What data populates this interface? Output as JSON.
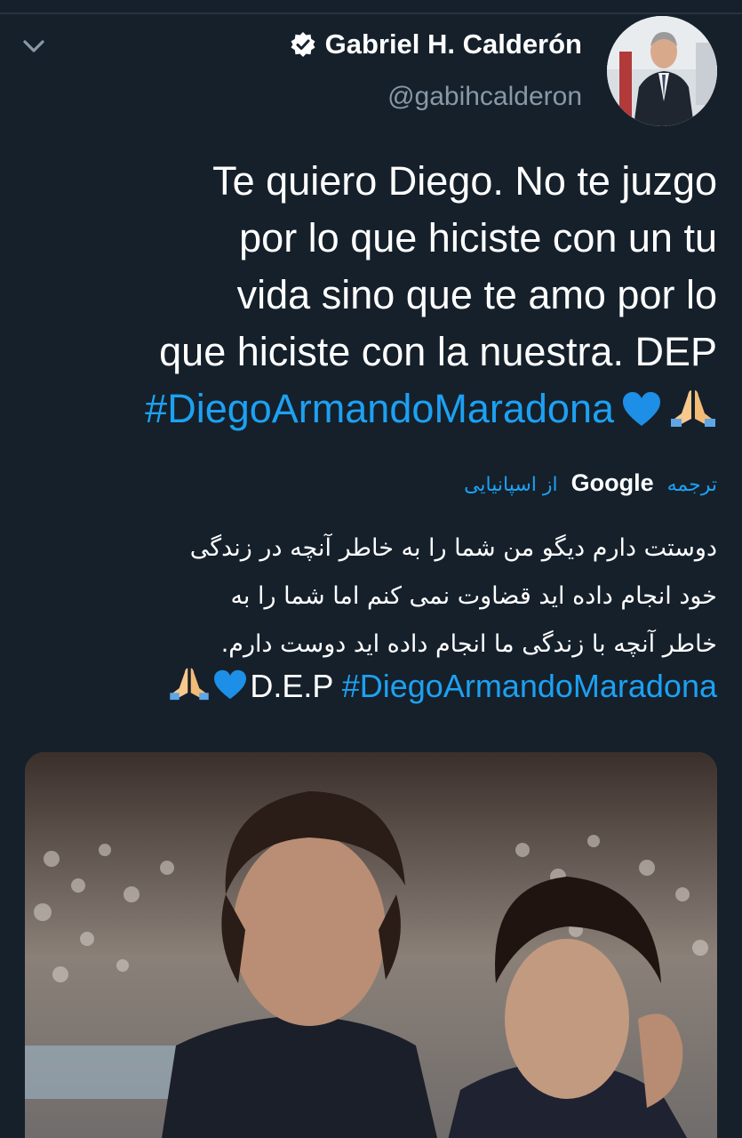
{
  "tweet": {
    "display_name": "Gabriel H. Calderón",
    "handle": "@gabihcalderon",
    "text_lines": [
      "Te quiero Diego. No te juzgo",
      "por lo que hiciste con un tu",
      "vida sino que te amo por lo",
      "que hiciste con la nuestra. DEP"
    ],
    "hashtag": "#DiegoArmandoMaradona"
  },
  "translation": {
    "label_translate": "ترجمه",
    "label_google": "Google",
    "label_from": "از اسپانیایی",
    "lines": [
      "دوستت دارم دیگو من شما را به خاطر آنچه در زندگی",
      "خود انجام داده اید قضاوت نمی کنم اما شما را به",
      "خاطر آنچه با زندگی ما انجام داده اید دوست دارم."
    ],
    "dep": "D.E.P",
    "hashtag": "#DiegoArmandoMaradona"
  },
  "icons": {
    "chevron": "chevron-down-icon",
    "verified": "verified-badge-icon",
    "heart": "blue-heart-emoji",
    "pray": "folded-hands-emoji"
  },
  "colors": {
    "background": "#15202b",
    "link": "#1da1f2",
    "secondary_text": "#8899a6"
  }
}
